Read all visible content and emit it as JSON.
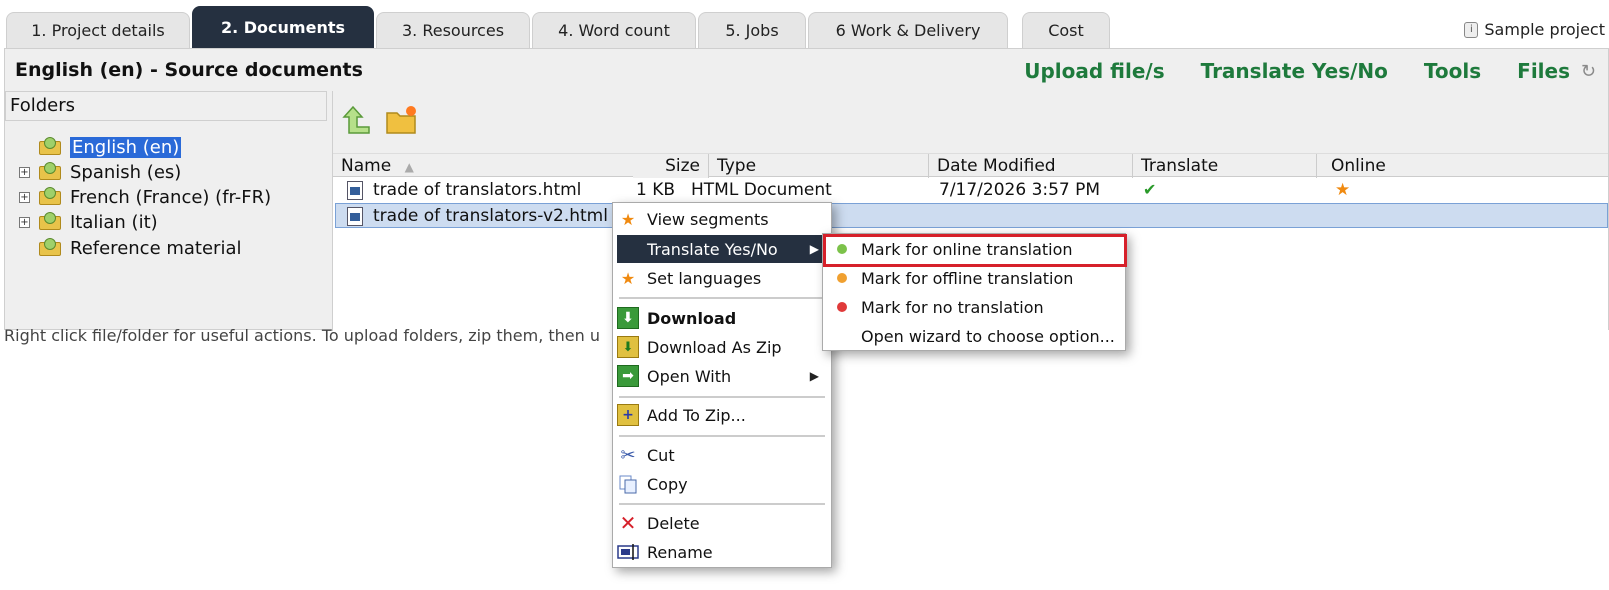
{
  "tabs": [
    {
      "label": "1. Project details",
      "active": false
    },
    {
      "label": "2. Documents",
      "active": true
    },
    {
      "label": "3. Resources",
      "active": false
    },
    {
      "label": "4. Word count",
      "active": false
    },
    {
      "label": "5. Jobs",
      "active": false
    },
    {
      "label": "6 Work & Delivery",
      "active": false
    },
    {
      "label": "Cost",
      "active": false
    }
  ],
  "sample_project": "Sample project",
  "panel": {
    "title": "English (en) - Source documents",
    "actions": [
      "Upload file/s",
      "Translate Yes/No",
      "Tools",
      "Files"
    ]
  },
  "folders": {
    "header": "Folders",
    "items": [
      {
        "label": "English (en)",
        "expandable": false,
        "selected": true
      },
      {
        "label": "Spanish (es)",
        "expandable": true,
        "selected": false
      },
      {
        "label": "French (France) (fr-FR)",
        "expandable": true,
        "selected": false
      },
      {
        "label": "Italian (it)",
        "expandable": true,
        "selected": false
      },
      {
        "label": "Reference material",
        "expandable": false,
        "selected": false
      }
    ]
  },
  "files": {
    "columns": [
      "Name",
      "Size",
      "Type",
      "Date Modified",
      "Translate",
      "Online"
    ],
    "rows": [
      {
        "name": "trade of translators.html",
        "size": "1 KB",
        "type": "HTML Document",
        "date": "7/17/2026 3:57 PM",
        "translate": "check-icon",
        "online": "star-icon"
      },
      {
        "name": "trade of translators-v2.html",
        "size": "",
        "type": "",
        "date": "",
        "translate": "",
        "online": ""
      }
    ]
  },
  "hint": "Right click file/folder for useful actions. To upload folders, zip them, then u",
  "context_menu": {
    "items": [
      {
        "label": "View segments",
        "icon": "star-icon"
      },
      {
        "label": "Translate Yes/No",
        "icon": "",
        "submenu": true
      },
      {
        "label": "Set languages",
        "icon": "star-icon"
      },
      {
        "label": "Download",
        "icon": "download-icon",
        "bold": true
      },
      {
        "label": "Download As Zip",
        "icon": "zip-download-icon"
      },
      {
        "label": "Open With",
        "icon": "open-with-icon",
        "submenu": true
      },
      {
        "label": "Add To Zip...",
        "icon": "add-zip-icon"
      },
      {
        "label": "Cut",
        "icon": "scissors-icon"
      },
      {
        "label": "Copy",
        "icon": "copy-icon"
      },
      {
        "label": "Delete",
        "icon": "delete-x-icon"
      },
      {
        "label": "Rename",
        "icon": "rename-icon"
      }
    ]
  },
  "submenu": {
    "items": [
      {
        "label": "Mark for online translation",
        "dot_color": "#7cc24a"
      },
      {
        "label": "Mark for offline translation",
        "dot_color": "#f0a030"
      },
      {
        "label": "Mark for no translation",
        "dot_color": "#e03a3a"
      },
      {
        "label": "Open wizard to choose option...",
        "dot_color": ""
      }
    ]
  },
  "colors": {
    "accent_green": "#1e7a3c",
    "active_tab": "#253040",
    "selection_blue": "#2a6ad8",
    "highlight_red": "#d6202a"
  }
}
